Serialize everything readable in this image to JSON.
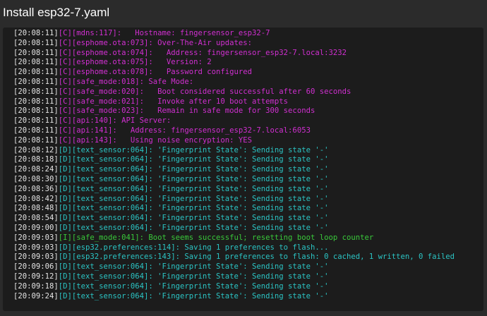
{
  "window": {
    "title": "Install esp32-7.yaml"
  },
  "colors": {
    "timestamp": "#e4e4e4",
    "config": "#d02fd0",
    "debug": "#2bc4c4",
    "info": "#39c83a"
  },
  "log_lines": [
    {
      "timestamp": "[20:08:11]",
      "level": "config",
      "message": "[C][mdns:117]:   Hostname: fingersensor_esp32-7"
    },
    {
      "timestamp": "[20:08:11]",
      "level": "config",
      "message": "[C][esphome.ota:073]: Over-The-Air updates:"
    },
    {
      "timestamp": "[20:08:11]",
      "level": "config",
      "message": "[C][esphome.ota:074]:   Address: fingersensor_esp32-7.local:3232"
    },
    {
      "timestamp": "[20:08:11]",
      "level": "config",
      "message": "[C][esphome.ota:075]:   Version: 2"
    },
    {
      "timestamp": "[20:08:11]",
      "level": "config",
      "message": "[C][esphome.ota:078]:   Password configured"
    },
    {
      "timestamp": "[20:08:11]",
      "level": "config",
      "message": "[C][safe_mode:018]: Safe Mode:"
    },
    {
      "timestamp": "[20:08:11]",
      "level": "config",
      "message": "[C][safe_mode:020]:   Boot considered successful after 60 seconds"
    },
    {
      "timestamp": "[20:08:11]",
      "level": "config",
      "message": "[C][safe_mode:021]:   Invoke after 10 boot attempts"
    },
    {
      "timestamp": "[20:08:11]",
      "level": "config",
      "message": "[C][safe_mode:023]:   Remain in safe mode for 300 seconds"
    },
    {
      "timestamp": "[20:08:11]",
      "level": "config",
      "message": "[C][api:140]: API Server:"
    },
    {
      "timestamp": "[20:08:11]",
      "level": "config",
      "message": "[C][api:141]:   Address: fingersensor_esp32-7.local:6053"
    },
    {
      "timestamp": "[20:08:11]",
      "level": "config",
      "message": "[C][api:143]:   Using noise encryption: YES"
    },
    {
      "timestamp": "[20:08:12]",
      "level": "debug",
      "message": "[D][text_sensor:064]: 'Fingerprint State': Sending state '-'"
    },
    {
      "timestamp": "[20:08:18]",
      "level": "debug",
      "message": "[D][text_sensor:064]: 'Fingerprint State': Sending state '-'"
    },
    {
      "timestamp": "[20:08:24]",
      "level": "debug",
      "message": "[D][text_sensor:064]: 'Fingerprint State': Sending state '-'"
    },
    {
      "timestamp": "[20:08:30]",
      "level": "debug",
      "message": "[D][text_sensor:064]: 'Fingerprint State': Sending state '-'"
    },
    {
      "timestamp": "[20:08:36]",
      "level": "debug",
      "message": "[D][text_sensor:064]: 'Fingerprint State': Sending state '-'"
    },
    {
      "timestamp": "[20:08:42]",
      "level": "debug",
      "message": "[D][text_sensor:064]: 'Fingerprint State': Sending state '-'"
    },
    {
      "timestamp": "[20:08:48]",
      "level": "debug",
      "message": "[D][text_sensor:064]: 'Fingerprint State': Sending state '-'"
    },
    {
      "timestamp": "[20:08:54]",
      "level": "debug",
      "message": "[D][text_sensor:064]: 'Fingerprint State': Sending state '-'"
    },
    {
      "timestamp": "[20:09:00]",
      "level": "debug",
      "message": "[D][text_sensor:064]: 'Fingerprint State': Sending state '-'"
    },
    {
      "timestamp": "[20:09:03]",
      "level": "info",
      "message": "[I][safe_mode:041]: Boot seems successful; resetting boot loop counter"
    },
    {
      "timestamp": "[20:09:03]",
      "level": "debug",
      "message": "[D][esp32.preferences:114]: Saving 1 preferences to flash..."
    },
    {
      "timestamp": "[20:09:03]",
      "level": "debug",
      "message": "[D][esp32.preferences:143]: Saving 1 preferences to flash: 0 cached, 1 written, 0 failed"
    },
    {
      "timestamp": "[20:09:06]",
      "level": "debug",
      "message": "[D][text_sensor:064]: 'Fingerprint State': Sending state '-'"
    },
    {
      "timestamp": "[20:09:12]",
      "level": "debug",
      "message": "[D][text_sensor:064]: 'Fingerprint State': Sending state '-'"
    },
    {
      "timestamp": "[20:09:18]",
      "level": "debug",
      "message": "[D][text_sensor:064]: 'Fingerprint State': Sending state '-'"
    },
    {
      "timestamp": "[20:09:24]",
      "level": "debug",
      "message": "[D][text_sensor:064]: 'Fingerprint State': Sending state '-'"
    }
  ]
}
